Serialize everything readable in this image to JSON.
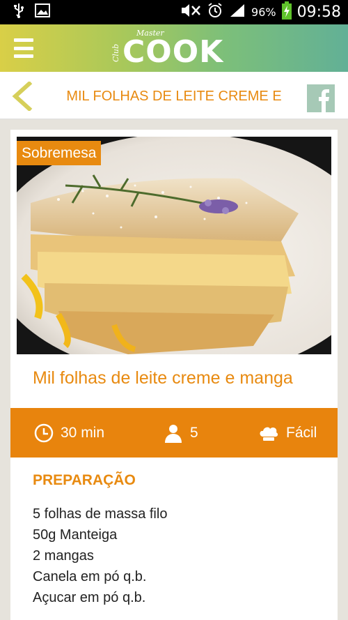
{
  "status_bar": {
    "battery": "96%",
    "time": "09:58",
    "icons": [
      "usb-icon",
      "image-icon",
      "mute-icon",
      "alarm-icon",
      "signal-icon",
      "battery-charging-icon"
    ]
  },
  "app_bar": {
    "logo_master": "Master",
    "logo_club": "Club",
    "logo_cook": "COOK",
    "accent_gradient": [
      "#d9cf47",
      "#62b096"
    ]
  },
  "title_bar": {
    "title": "MIL FOLHAS DE LEITE CREME E",
    "share_label": "f"
  },
  "recipe": {
    "category": "Sobremesa",
    "title": "Mil folhas de leite creme e manga",
    "time": "30 min",
    "servings": "5",
    "difficulty": "Fácil",
    "section_title": "PREPARAÇÃO",
    "ingredients": [
      "5 folhas de massa filo",
      "50g Manteiga",
      "2 mangas",
      "Canela em pó q.b.",
      "Açucar em pó q.b."
    ]
  },
  "colors": {
    "accent": "#e88a10",
    "info_bar": "#e8840d",
    "background": "#e6e3dc"
  }
}
